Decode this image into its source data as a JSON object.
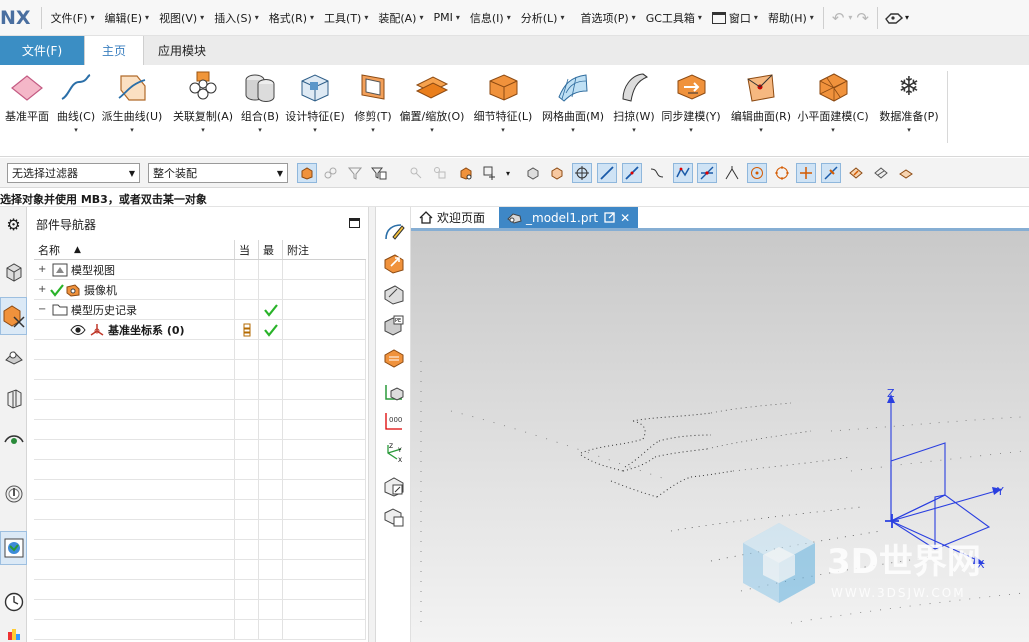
{
  "app": {
    "logo": "NX"
  },
  "menubar": {
    "items": [
      {
        "label": "文件(F)"
      },
      {
        "label": "编辑(E)"
      },
      {
        "label": "视图(V)"
      },
      {
        "label": "插入(S)"
      },
      {
        "label": "格式(R)"
      },
      {
        "label": "工具(T)"
      },
      {
        "label": "装配(A)"
      },
      {
        "label": "PMI"
      },
      {
        "label": "信息(I)"
      },
      {
        "label": "分析(L)"
      },
      {
        "label": "首选项(P)"
      },
      {
        "label": "GC工具箱"
      },
      {
        "label": "窗口"
      },
      {
        "label": "帮助(H)"
      }
    ]
  },
  "ribbon_tabs": {
    "file": "文件(F)",
    "home": "主页",
    "modules": "应用模块"
  },
  "ribbon": {
    "buttons": [
      {
        "label": "基准平面"
      },
      {
        "label": "曲线(C)"
      },
      {
        "label": "派生曲线(U)"
      },
      {
        "label": "关联复制(A)"
      },
      {
        "label": "组合(B)"
      },
      {
        "label": "设计特征(E)"
      },
      {
        "label": "修剪(T)"
      },
      {
        "label": "偏置/缩放(O)"
      },
      {
        "label": "细节特征(L)"
      },
      {
        "label": "网格曲面(M)"
      },
      {
        "label": "扫掠(W)"
      },
      {
        "label": "同步建模(Y)"
      },
      {
        "label": "编辑曲面(R)"
      },
      {
        "label": "小平面建模(C)"
      },
      {
        "label": "数据准备(P)"
      }
    ]
  },
  "filterbar": {
    "type_filter": "无选择过滤器",
    "scope": "整个装配"
  },
  "status": {
    "prompt": "选择对象并使用 MB3，或者双击某一对象"
  },
  "navigator": {
    "title": "部件导航器",
    "columns": {
      "name": "名称",
      "current": "当",
      "latest": "最",
      "note": "附注"
    },
    "rows": [
      {
        "label": "模型视图"
      },
      {
        "label": "摄像机"
      },
      {
        "label": "模型历史记录"
      },
      {
        "label": "基准坐标系 (0)"
      }
    ]
  },
  "doc_tabs": {
    "welcome": "欢迎页面",
    "model": "_model1.prt"
  },
  "triad": {
    "x": "X",
    "y": "Y",
    "z": "Z"
  },
  "watermark": {
    "brand": "3D世界网",
    "url": "WWW.3DSJW.COM"
  },
  "colors": {
    "accent": "#3b8ec4",
    "check": "#2ab32a",
    "csys": "#2a3fe0"
  }
}
